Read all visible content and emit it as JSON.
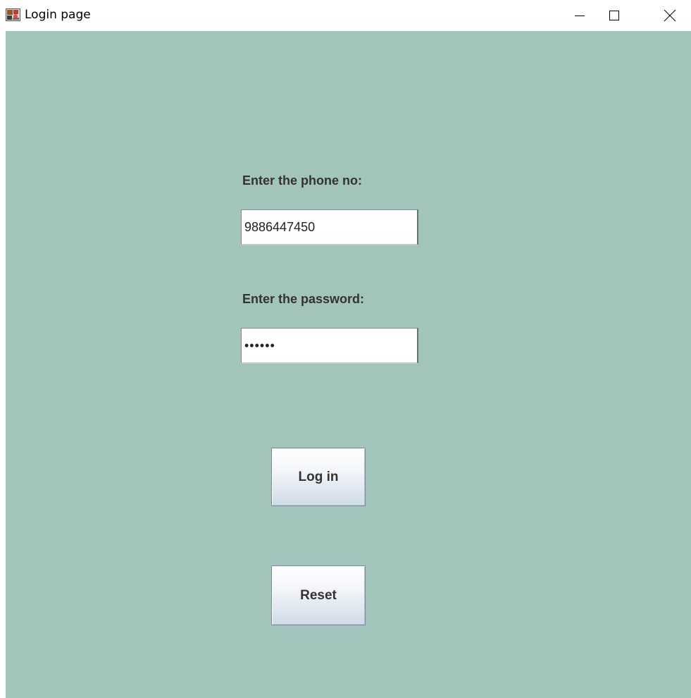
{
  "window": {
    "title": "Login page",
    "icon": "app-icon",
    "controls": {
      "minimize_icon": "minimize-icon",
      "maximize_icon": "maximize-icon",
      "close_icon": "close-icon"
    }
  },
  "form": {
    "phone_label": "Enter the phone no:",
    "phone_value": "9886447450",
    "password_label": "Enter the password:",
    "password_value": "••••••",
    "login_label": "Log in",
    "reset_label": "Reset"
  },
  "colors": {
    "background": "#a2c4ba",
    "label_text": "#333333"
  }
}
